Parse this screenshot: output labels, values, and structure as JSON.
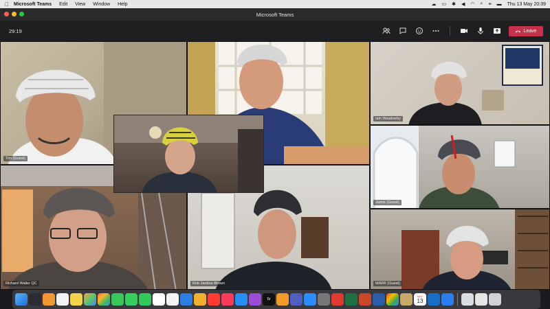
{
  "menubar": {
    "app_name": "Microsoft Teams",
    "menus": [
      "Edit",
      "View",
      "Window",
      "Help"
    ],
    "clock": "Thu 13 May  20:39"
  },
  "window": {
    "title": "Microsoft Teams"
  },
  "toolbar": {
    "timer": "29:19",
    "leave_label": "Leave",
    "icons": [
      "people-icon",
      "chat-icon",
      "reactions-icon",
      "more-icon",
      "camera-icon",
      "mic-icon",
      "share-icon"
    ]
  },
  "participants": [
    {
      "name": "Tim (Guest)"
    },
    {
      "name": ""
    },
    {
      "name": ""
    },
    {
      "name": "Iain Weatherby"
    },
    {
      "name": "Jamie (Guest)"
    },
    {
      "name": "Richard Waller QC"
    },
    {
      "name": "Rob Jardine-Brown"
    },
    {
      "name": "MARK (Guest)"
    }
  ],
  "tile_menu": "···",
  "dock": {
    "calendar_day": "13",
    "calendar_month": "MAY",
    "tv_label": "tv"
  }
}
